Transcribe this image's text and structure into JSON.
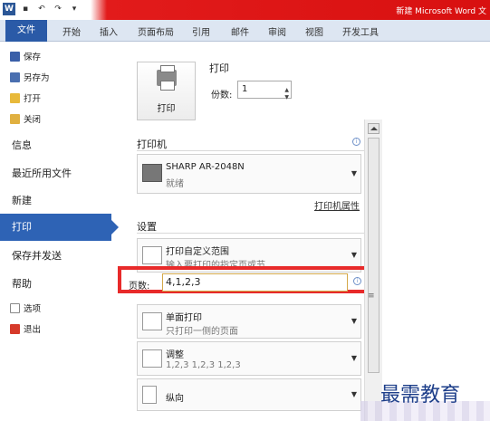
{
  "window": {
    "title": "新建 Microsoft Word 文"
  },
  "qat": {
    "app_glyph": "W",
    "save": "▪",
    "undo": "↶",
    "redo": "↷",
    "more": "▾"
  },
  "tabs": {
    "file": "文件",
    "items": [
      "开始",
      "插入",
      "页面布局",
      "引用",
      "邮件",
      "审阅",
      "视图",
      "开发工具"
    ]
  },
  "sidebar": {
    "small": [
      "保存",
      "另存为",
      "打开",
      "关闭"
    ],
    "big": [
      "信息",
      "最近所用文件",
      "新建"
    ],
    "active": "打印",
    "big2": [
      "保存并发送",
      "帮助"
    ],
    "small2": [
      "选项",
      "退出"
    ]
  },
  "print": {
    "section_title": "打印",
    "button_label": "打印",
    "copies_label": "份数:",
    "copies_value": "1"
  },
  "printer": {
    "section_title": "打印机",
    "name": "SHARP AR-2048N",
    "status": "就绪",
    "properties_link": "打印机属性"
  },
  "settings": {
    "section_title": "设置",
    "range_title": "打印自定义范围",
    "range_desc": "输入要打印的指定页或节",
    "pages_label": "页数:",
    "pages_value": "4,1,2,3",
    "sides_title": "单面打印",
    "sides_desc": "只打印一侧的页面",
    "collate_title": "调整",
    "collate_desc": "1,2,3   1,2,3   1,2,3",
    "orientation": "纵向"
  },
  "watermark": "最需教育",
  "colors": {
    "accent": "#2e63b5",
    "highlight": "#e82a2a",
    "titlebar": "#d81010"
  }
}
